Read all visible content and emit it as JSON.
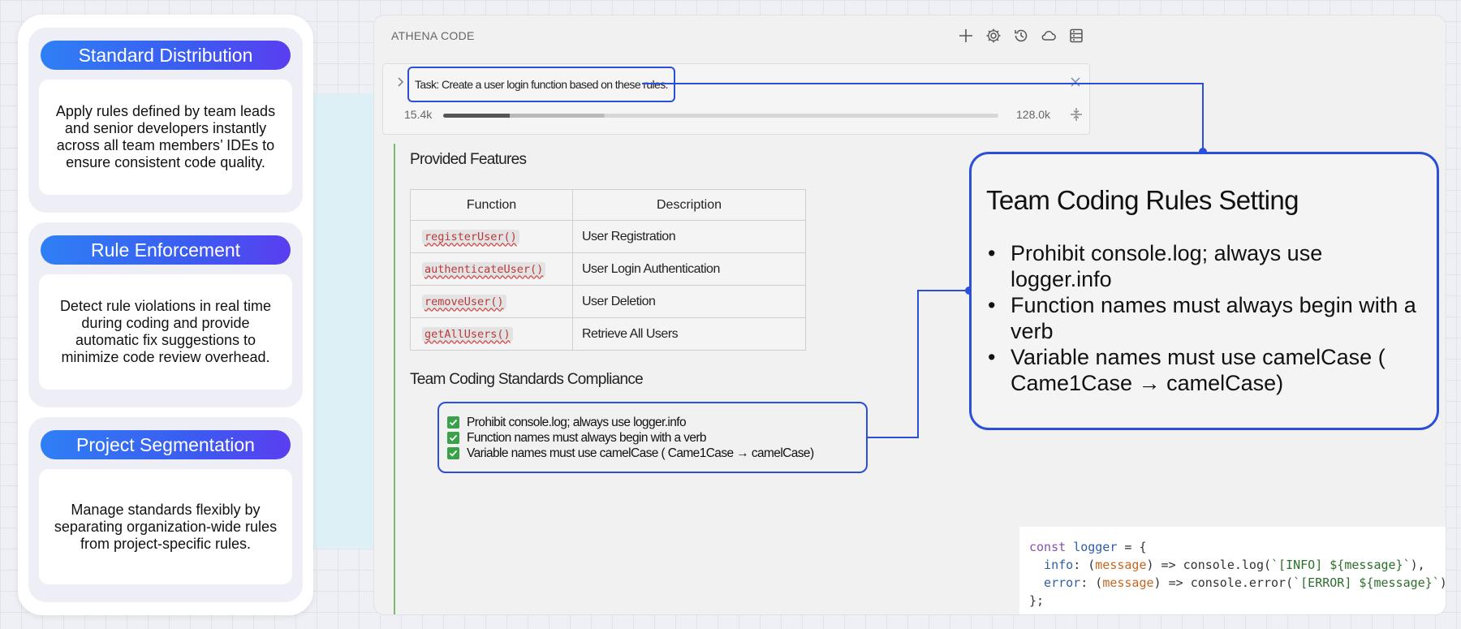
{
  "features": [
    {
      "title": "Standard Distribution",
      "body": "Apply rules defined by team leads and senior developers instantly across all team members’ IDEs to ensure consistent code quality."
    },
    {
      "title": "Rule Enforcement",
      "body": "Detect rule violations in real time during coding and provide automatic fix suggestions to minimize code review overhead."
    },
    {
      "title": "Project Segmentation",
      "body": "Manage standards flexibly by separating organization-wide rules from project-specific rules."
    }
  ],
  "app": {
    "title": "ATHENA CODE",
    "toolbar_icons": [
      "plus-icon",
      "gear-icon",
      "history-icon",
      "cloud-icon",
      "database-icon"
    ]
  },
  "task": {
    "text": "Task: Create a user login function based on these rules.",
    "tokens_used": "15.4k",
    "tokens_max": "128.0k",
    "progress": 0.122
  },
  "provided_features": {
    "title": "Provided Features",
    "headers": [
      "Function",
      "Description"
    ],
    "rows": [
      {
        "fn": "registerUser()",
        "desc": "User Registration"
      },
      {
        "fn": "authenticateUser()",
        "desc": "User Login Authentication"
      },
      {
        "fn": "removeUser()",
        "desc": "User Deletion"
      },
      {
        "fn": "getAllUsers()",
        "desc": "Retrieve All Users"
      }
    ]
  },
  "compliance": {
    "title": "Team Coding Standards Compliance",
    "items": [
      "Prohibit console.log; always use logger.info",
      "Function names must always begin with a verb",
      "Variable names must use camelCase ( Came1Case → camelCase)"
    ]
  },
  "rules_setting": {
    "title": "Team Coding Rules Setting",
    "items": [
      "Prohibit console.log; always use logger.info",
      "Function names must always begin with a verb",
      "Variable names must use camelCase ( Came1Case → camelCase)"
    ]
  },
  "code": {
    "line1_kw": "const",
    "line1_var": "logger",
    "line1_rest": " = {",
    "line2_key": "  info",
    "line2_param": "message",
    "line2_call": "console.log",
    "line2_str": "`[INFO] ${message}`",
    "line3_key": "  error",
    "line3_param": "message",
    "line3_call": "console.error",
    "line3_str": "`[ERROR] ${message}`",
    "line4": "};"
  },
  "colors": {
    "accent": "#2b4fd8",
    "pill_start": "#2f7ff5",
    "pill_end": "#5a3ef0",
    "check": "#3aa14a",
    "timeline": "#7dbb6a"
  }
}
